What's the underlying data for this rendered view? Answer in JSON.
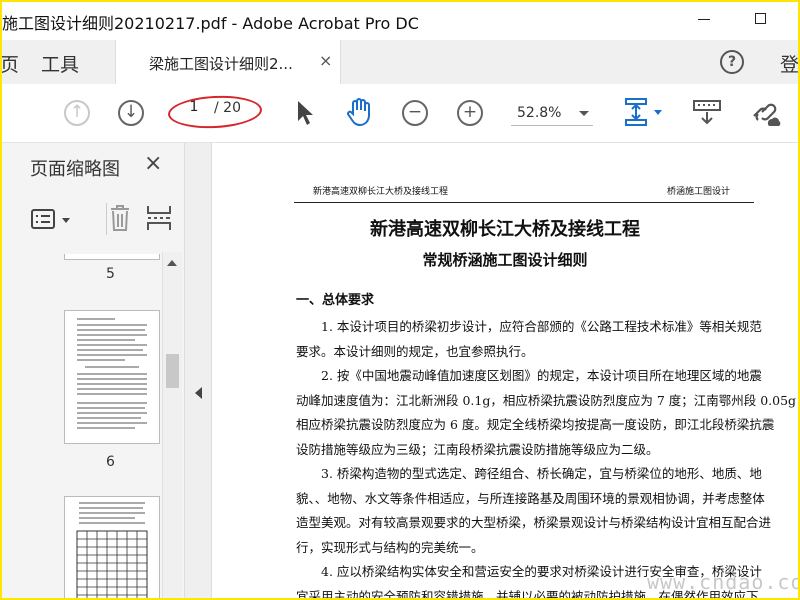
{
  "window": {
    "title": "施工图设计细则20210217.pdf - Adobe Acrobat Pro DC"
  },
  "tabbar": {
    "home_label": "页",
    "tools_label": "工具",
    "doc_tab_label": "梁施工图设计细则2...",
    "close_glyph": "×",
    "help_glyph": "?",
    "login_label": "登"
  },
  "toolbar": {
    "current_page": "1",
    "total_pages": "/ 20",
    "zoom": "52.8%"
  },
  "panel": {
    "title": "页面缩略图",
    "close_glyph": "×",
    "thumbnails": [
      {
        "page": "5"
      },
      {
        "page": "6"
      }
    ]
  },
  "document": {
    "header_left": "新港高速双柳长江大桥及接线工程",
    "header_right": "桥涵施工图设计",
    "title": "新港高速双柳长江大桥及接线工程",
    "subtitle": "常规桥涵施工图设计细则",
    "section": "一、总体要求",
    "lines": [
      "　　1. 本设计项目的桥梁初步设计，应符合部颁的《公路工程技术标准》等相关规范",
      "要求。本设计细则的规定，也宜参照执行。",
      "　　2. 按《中国地震动峰值加速度区划图》的规定，本设计项目所在地理区域的地震",
      "动峰加速度值为：江北新洲段 0.1g，相应桥梁抗震设防烈度应为 7 度；江南鄂州段 0.05g，",
      "相应桥梁抗震设防烈度应为 6 度。规定全线桥梁均按提高一度设防，即江北段桥梁抗震",
      "设防措施等级应为三级；江南段桥梁抗震设防措施等级应为二级。",
      "　　3. 桥梁构造物的型式选定、跨径组合、桥长确定，宜与桥梁位的地形、地质、地",
      "貌、、地物、水文等条件相适应，与所连接路基及周围环境的景观相协调，并考虑整体",
      "造型美观。对有较高景观要求的大型桥梁，桥梁景观设计与桥梁结构设计宜相互配合进",
      "行，实现形式与结构的完美统一。",
      "　　4. 应以桥梁结构实体安全和营运安全的要求对桥梁设计进行安全审查，桥梁设计",
      "宜采用主动的安全预防和容错措施，并辅以必要的被动防护措施，在偶然作用效应下，"
    ]
  },
  "watermark": "www.cndao.com",
  "colors": {
    "frame": "#ffe600",
    "annotation": "#d6262b",
    "accent": "#1a6fc9"
  }
}
